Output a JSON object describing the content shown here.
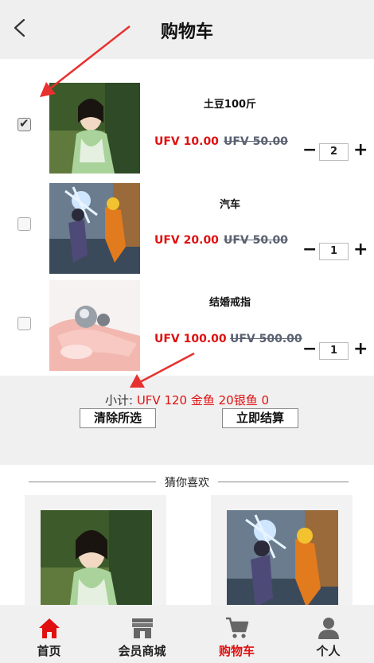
{
  "header": {
    "title": "购物车"
  },
  "cart": {
    "items": [
      {
        "name": "土豆100斤",
        "price": "UFV 10.00",
        "original_price": "UFV 50.00",
        "quantity": "2",
        "checked": true
      },
      {
        "name": "汽车",
        "price": "UFV 20.00",
        "original_price": "UFV 50.00",
        "quantity": "1",
        "checked": false
      },
      {
        "name": "结婚戒指",
        "price": "UFV 100.00",
        "original_price": "UFV 500.00",
        "quantity": "1",
        "checked": false
      }
    ]
  },
  "summary": {
    "label": "小计:",
    "amount": "UFV 120 金鱼 20银鱼 0",
    "clear_label": "清除所选",
    "checkout_label": "立即结算"
  },
  "recommend": {
    "title": "猜你喜欢"
  },
  "tabbar": {
    "tabs": [
      {
        "label": "首页"
      },
      {
        "label": "会员商城"
      },
      {
        "label": "购物车"
      },
      {
        "label": "个人"
      }
    ]
  },
  "colors": {
    "accent": "#e01010",
    "original_price": "#5a6170",
    "annotation_arrow": "#e8312f"
  },
  "icons": [
    "back-chevron-icon",
    "home-icon",
    "store-icon",
    "cart-icon",
    "person-icon",
    "minus-icon",
    "plus-icon",
    "check-icon"
  ]
}
